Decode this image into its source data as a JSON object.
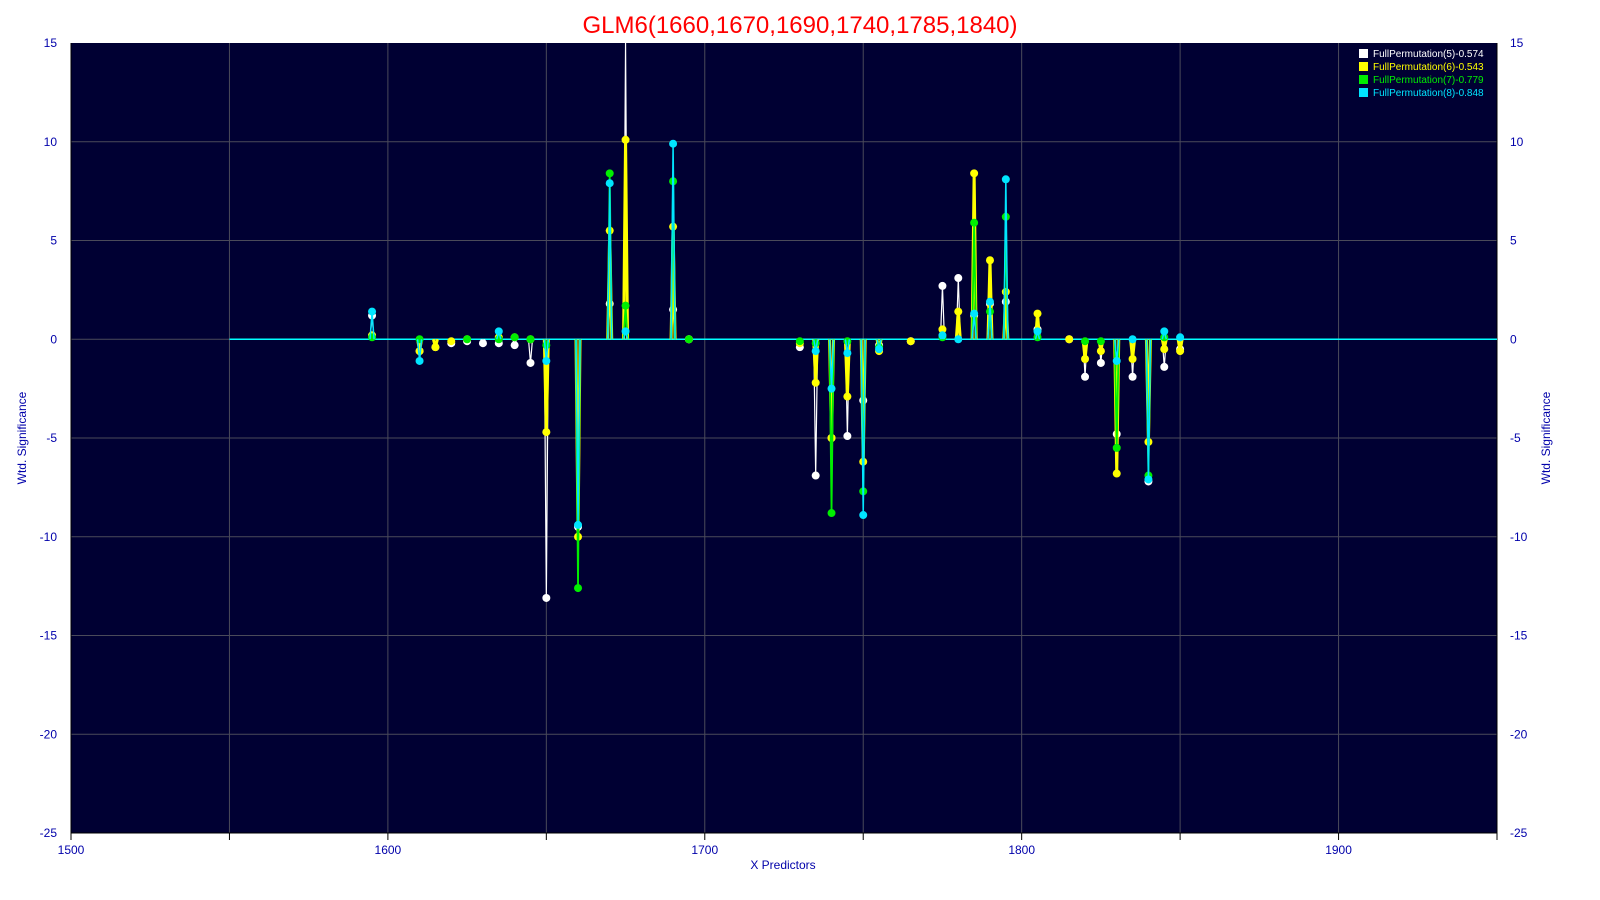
{
  "chart_data": {
    "type": "line",
    "title": "GLM6(1660,1670,1690,1740,1785,1840)",
    "xlabel": "X Predictors",
    "ylabel_left": "Wtd. Significance",
    "ylabel_right": "Wtd. Significance",
    "xlim": [
      1500,
      1950
    ],
    "ylim": [
      -25,
      15
    ],
    "x_ticks": [
      "1500",
      "1600",
      "1700",
      "1800",
      "1900"
    ],
    "y_ticks": [
      "15",
      "10",
      "5",
      "0",
      "-5",
      "-10",
      "-15",
      "-20",
      "-25"
    ],
    "grid": true,
    "legend_position": "top-right",
    "colors": {
      "title": "#ff0000",
      "plot_bg": "#000033",
      "grid": "#4a4a5a",
      "axis_text": "#0000aa",
      "baseline": "#00ffff"
    },
    "series": [
      {
        "name": "FullPermutation(5)-0.574",
        "color": "#ffffff",
        "points": [
          [
            1595,
            1.2
          ],
          [
            1610,
            -0.6
          ],
          [
            1615,
            -0.4
          ],
          [
            1620,
            -0.2
          ],
          [
            1625,
            -0.1
          ],
          [
            1630,
            -0.2
          ],
          [
            1635,
            -0.2
          ],
          [
            1640,
            -0.3
          ],
          [
            1645,
            -1.2
          ],
          [
            1650,
            -13.1
          ],
          [
            1660,
            -9.5
          ],
          [
            1670,
            1.8
          ],
          [
            1675,
            16.5
          ],
          [
            1690,
            1.5
          ],
          [
            1695,
            0.0
          ],
          [
            1730,
            -0.4
          ],
          [
            1735,
            -6.9
          ],
          [
            1740,
            -5.0
          ],
          [
            1745,
            -4.9
          ],
          [
            1750,
            -3.1
          ],
          [
            1755,
            -0.3
          ],
          [
            1765,
            -0.1
          ],
          [
            1775,
            2.7
          ],
          [
            1780,
            3.1
          ],
          [
            1785,
            1.2
          ],
          [
            1790,
            1.8
          ],
          [
            1795,
            1.9
          ],
          [
            1805,
            0.5
          ],
          [
            1815,
            0.0
          ],
          [
            1820,
            -1.9
          ],
          [
            1825,
            -1.2
          ],
          [
            1830,
            -4.8
          ],
          [
            1835,
            -1.9
          ],
          [
            1840,
            -7.2
          ],
          [
            1845,
            -1.4
          ],
          [
            1850,
            -0.5
          ]
        ]
      },
      {
        "name": "FullPermutation(6)-0.543",
        "color": "#ffff00",
        "points": [
          [
            1595,
            0.2
          ],
          [
            1610,
            -0.6
          ],
          [
            1615,
            -0.4
          ],
          [
            1620,
            -0.1
          ],
          [
            1625,
            0.0
          ],
          [
            1635,
            0.1
          ],
          [
            1640,
            0.1
          ],
          [
            1645,
            0.0
          ],
          [
            1650,
            -4.7
          ],
          [
            1660,
            -10.0
          ],
          [
            1670,
            5.5
          ],
          [
            1675,
            10.1
          ],
          [
            1690,
            5.7
          ],
          [
            1695,
            0.0
          ],
          [
            1730,
            -0.2
          ],
          [
            1735,
            -2.2
          ],
          [
            1740,
            -5.0
          ],
          [
            1745,
            -2.9
          ],
          [
            1750,
            -6.2
          ],
          [
            1755,
            -0.6
          ],
          [
            1765,
            -0.1
          ],
          [
            1775,
            0.5
          ],
          [
            1780,
            1.4
          ],
          [
            1785,
            8.4
          ],
          [
            1790,
            4.0
          ],
          [
            1795,
            2.4
          ],
          [
            1805,
            1.3
          ],
          [
            1815,
            0.0
          ],
          [
            1820,
            -1.0
          ],
          [
            1825,
            -0.6
          ],
          [
            1830,
            -6.8
          ],
          [
            1835,
            -1.0
          ],
          [
            1840,
            -5.2
          ],
          [
            1845,
            -0.5
          ],
          [
            1850,
            -0.6
          ]
        ]
      },
      {
        "name": "FullPermutation(7)-0.779",
        "color": "#00ee00",
        "points": [
          [
            1595,
            0.1
          ],
          [
            1610,
            0.0
          ],
          [
            1625,
            0.0
          ],
          [
            1635,
            0.0
          ],
          [
            1640,
            0.1
          ],
          [
            1645,
            0.0
          ],
          [
            1650,
            -0.3
          ],
          [
            1660,
            -12.6
          ],
          [
            1670,
            8.4
          ],
          [
            1675,
            1.7
          ],
          [
            1690,
            8.0
          ],
          [
            1695,
            0.0
          ],
          [
            1730,
            -0.1
          ],
          [
            1735,
            -0.2
          ],
          [
            1740,
            -8.8
          ],
          [
            1745,
            -0.1
          ],
          [
            1750,
            -7.7
          ],
          [
            1755,
            -0.4
          ],
          [
            1775,
            0.1
          ],
          [
            1785,
            5.9
          ],
          [
            1790,
            1.4
          ],
          [
            1795,
            6.2
          ],
          [
            1805,
            0.1
          ],
          [
            1820,
            -0.1
          ],
          [
            1825,
            -0.1
          ],
          [
            1830,
            -5.5
          ],
          [
            1840,
            -6.9
          ],
          [
            1845,
            0.1
          ]
        ]
      },
      {
        "name": "FullPermutation(8)-0.848",
        "color": "#00e5ff",
        "points": [
          [
            1595,
            1.4
          ],
          [
            1610,
            -1.1
          ],
          [
            1635,
            0.4
          ],
          [
            1650,
            -1.1
          ],
          [
            1660,
            -9.4
          ],
          [
            1670,
            7.9
          ],
          [
            1675,
            0.4
          ],
          [
            1690,
            9.9
          ],
          [
            1735,
            -0.6
          ],
          [
            1740,
            -2.5
          ],
          [
            1745,
            -0.7
          ],
          [
            1750,
            -8.9
          ],
          [
            1755,
            -0.5
          ],
          [
            1775,
            0.2
          ],
          [
            1780,
            0.0
          ],
          [
            1785,
            1.3
          ],
          [
            1790,
            1.9
          ],
          [
            1795,
            8.1
          ],
          [
            1805,
            0.4
          ],
          [
            1830,
            -1.1
          ],
          [
            1835,
            0.0
          ],
          [
            1840,
            -7.1
          ],
          [
            1845,
            0.4
          ],
          [
            1850,
            0.1
          ]
        ]
      }
    ]
  }
}
